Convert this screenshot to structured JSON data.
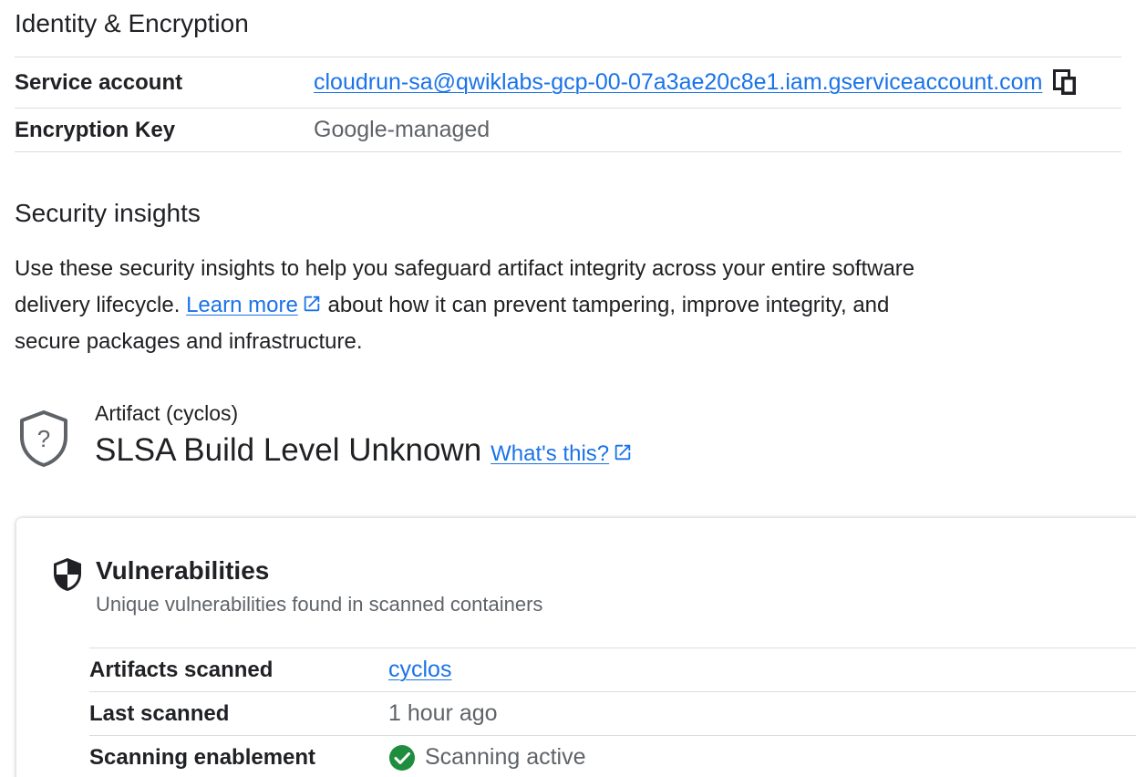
{
  "identity": {
    "title": "Identity & Encryption",
    "rows": [
      {
        "label": "Service account",
        "value": "cloudrun-sa@qwiklabs-gcp-00-07a3ae20c8e1.iam.gserviceaccount.com"
      },
      {
        "label": "Encryption Key",
        "value": "Google-managed"
      }
    ]
  },
  "security": {
    "title": "Security insights",
    "desc_before": "Use these security insights to help you safeguard artifact integrity across your entire software delivery lifecycle.",
    "learn_more": "Learn more",
    "desc_after": "about how it can prevent tampering, improve integrity, and secure packages and infrastructure."
  },
  "artifact": {
    "name": "Artifact (cyclos)",
    "slsa_level": "SLSA Build Level Unknown",
    "whats_this": "What's this?"
  },
  "vulnerabilities": {
    "title": "Vulnerabilities",
    "subtitle": "Unique vulnerabilities found in scanned containers",
    "rows": [
      {
        "label": "Artifacts scanned",
        "value": "cyclos"
      },
      {
        "label": "Last scanned",
        "value": "1 hour ago"
      },
      {
        "label": "Scanning enablement",
        "value": "Scanning active"
      }
    ]
  },
  "icons": {
    "copy": "copy-icon",
    "external": "external-link-icon",
    "shield_unknown": "shield-question-icon",
    "shield_vuln": "shield-icon",
    "check": "check-circle-icon"
  },
  "colors": {
    "link": "#1a73e8",
    "success": "#1e8e3e",
    "muted": "#5f6368"
  }
}
